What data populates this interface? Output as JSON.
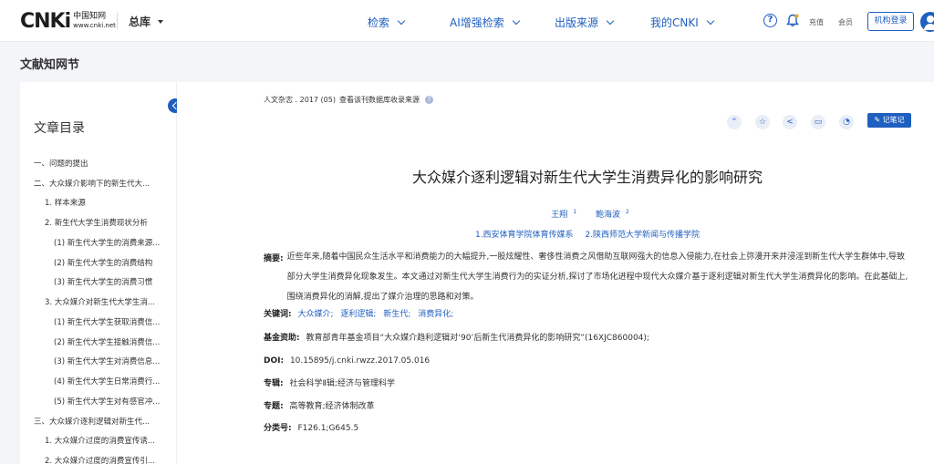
{
  "header": {
    "logo_mark": "CNKi",
    "logo_cn": "中国知网",
    "logo_url": "www.cnki.net",
    "site_menu": "总库",
    "nav": [
      "检索",
      "AI增强检索",
      "出版来源",
      "我的CNKI"
    ],
    "recharge": "充值",
    "member": "会员",
    "login": "机构登录"
  },
  "page_title": "文献知网节",
  "toc": {
    "title": "文章目录",
    "items": [
      "一、问题的提出",
      "二、大众媒介影响下的新生代大...",
      "1. 样本来源",
      "2. 新生代大学生消费现状分析",
      "(1) 新生代大学生的消费来源...",
      "(2) 新生代大学生的消费结构",
      "(3) 新生代大学生的消费习惯",
      "3. 大众媒介对新生代大学生消...",
      "(1) 新生代大学生获取消费信...",
      "(2) 新生代大学生接触消费信...",
      "(3) 新生代大学生对消费信息...",
      "(4) 新生代大学生日常消费行...",
      "(5) 新生代大学生对有感官冲...",
      "三、大众媒介逐利逻辑对新生代...",
      "1. 大众媒介过度的消费宣传诱...",
      "2. 大众媒介过度的消费宣传引..."
    ]
  },
  "article": {
    "source": "人文杂志 . 2017 (05)",
    "source_link": "查看该刊数据库收录来源",
    "note_button": "记笔记",
    "title": "大众媒介逐利逻辑对新生代大学生消费异化的影响研究",
    "authors": [
      {
        "name": "王翔",
        "sup": "1"
      },
      {
        "name": "鲍海波",
        "sup": "2"
      }
    ],
    "affiliations": [
      "1.西安体育学院体育传媒系",
      "2.陕西师范大学新闻与传播学院"
    ],
    "abstract_label": "摘要:",
    "abstract": "近些年来,随着中国民众生活水平和消费能力的大幅提升,一股炫耀性、奢侈性消费之风借助互联网强大的信息入侵能力,在社会上弥漫开来并浸淫到新生代大学生群体中,导致部分大学生消费异化现象发生。本文通过对新生代大学生消费行为的实证分析,探讨了市场化进程中现代大众媒介基于逐利逻辑对新生代大学生消费异化的影响。在此基础上,围绕消费异化的消解,提出了媒介治理的思路和对策。",
    "keywords_label": "关键词:",
    "keywords": [
      "大众媒介;",
      "逐利逻辑;",
      "新生代;",
      "消费异化;"
    ],
    "fund_label": "基金资助:",
    "fund": "教育部青年基金项目“大众媒介趋利逻辑对‘90’后新生代消费异化的影响研究”(16XJC860004);",
    "doi_label": "DOI:",
    "doi": "10.15895/j.cnki.rwzz.2017.05.016",
    "series_label": "专辑:",
    "series": "社会科学Ⅱ辑;经济与管理科学",
    "topic_label": "专题:",
    "topic": "高等教育;经济体制改革",
    "class_label": "分类号:",
    "class": "F126.1;G645.5"
  }
}
